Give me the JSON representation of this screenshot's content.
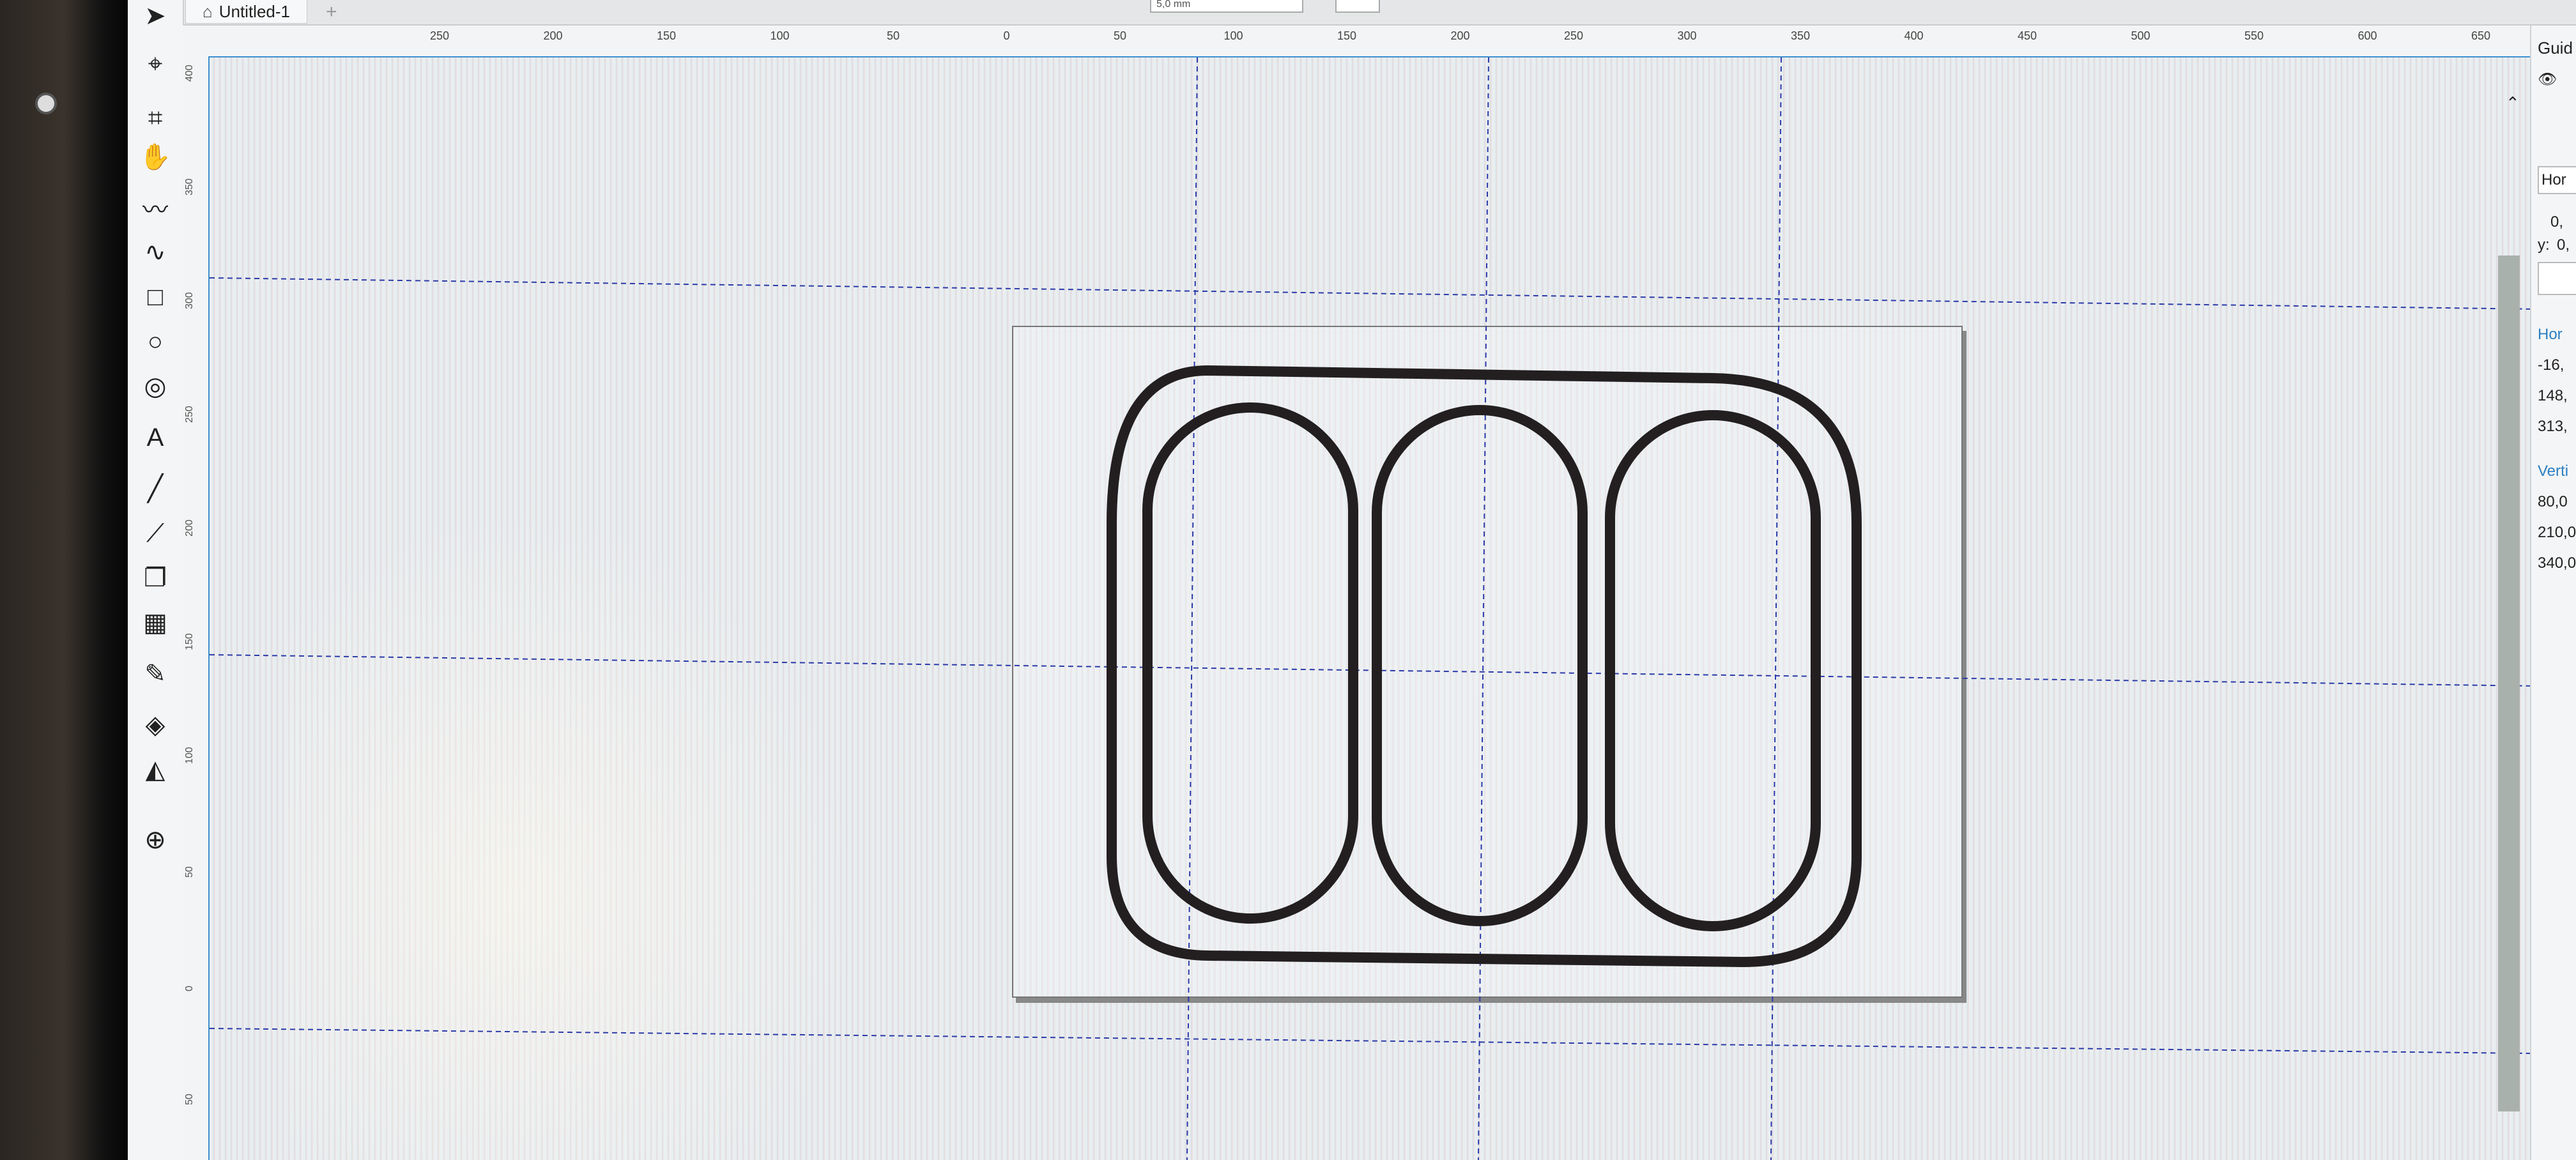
{
  "document": {
    "tab_title": "Untitled-1",
    "tab_add": "+",
    "top_field_value": "5,0 mm"
  },
  "tools": [
    {
      "name": "selector-tool-icon",
      "glyph": "➤"
    },
    {
      "name": "node-tool-icon",
      "glyph": "⌖"
    },
    {
      "name": "crop-tool-icon",
      "glyph": "⌗"
    },
    {
      "name": "pan-tool-icon",
      "glyph": "✋"
    },
    {
      "name": "freehand-tool-icon",
      "glyph": "〰"
    },
    {
      "name": "bezier-tool-icon",
      "glyph": "∿"
    },
    {
      "name": "rectangle-tool-icon",
      "glyph": "□"
    },
    {
      "name": "ellipse-tool-icon",
      "glyph": "○"
    },
    {
      "name": "spiral-tool-icon",
      "glyph": "◎"
    },
    {
      "name": "text-tool-icon",
      "glyph": "A"
    },
    {
      "name": "line-tool-icon",
      "glyph": "╱"
    },
    {
      "name": "connector-tool-icon",
      "glyph": "⟋"
    },
    {
      "name": "shadow-tool-icon",
      "glyph": "❐"
    },
    {
      "name": "transparency-tool-icon",
      "glyph": "▦"
    },
    {
      "name": "eyedropper-tool-icon",
      "glyph": "✎"
    },
    {
      "name": "fill-tool-icon",
      "glyph": "◈"
    },
    {
      "name": "smart-fill-tool-icon",
      "glyph": "◭"
    },
    {
      "name": "add-tool-icon",
      "glyph": "⊕"
    }
  ],
  "ruler": {
    "top_labels": [
      "250",
      "200",
      "150",
      "100",
      "50",
      "0",
      "50",
      "100",
      "150",
      "200",
      "250",
      "300",
      "350",
      "400",
      "450",
      "500",
      "550",
      "600",
      "650"
    ],
    "unit": "millimeters",
    "left_labels": [
      "400",
      "350",
      "300",
      "250",
      "200",
      "150",
      "100",
      "50",
      "0",
      "50"
    ]
  },
  "right_panel": {
    "title": "Guid",
    "dropdown": "Hor",
    "y_label": "y:",
    "field_x": "0,",
    "field_y": "0,",
    "horizontal_header": "Hor",
    "horizontal_values": [
      "-16,",
      "148,",
      "313,"
    ],
    "vertical_header": "Verti",
    "vertical_values": [
      "80,0",
      "210,0",
      "340,0"
    ]
  },
  "colors": {
    "accent": "#3d8fd0",
    "guide": "#2a3aa8",
    "shape_stroke": "#231f20"
  }
}
